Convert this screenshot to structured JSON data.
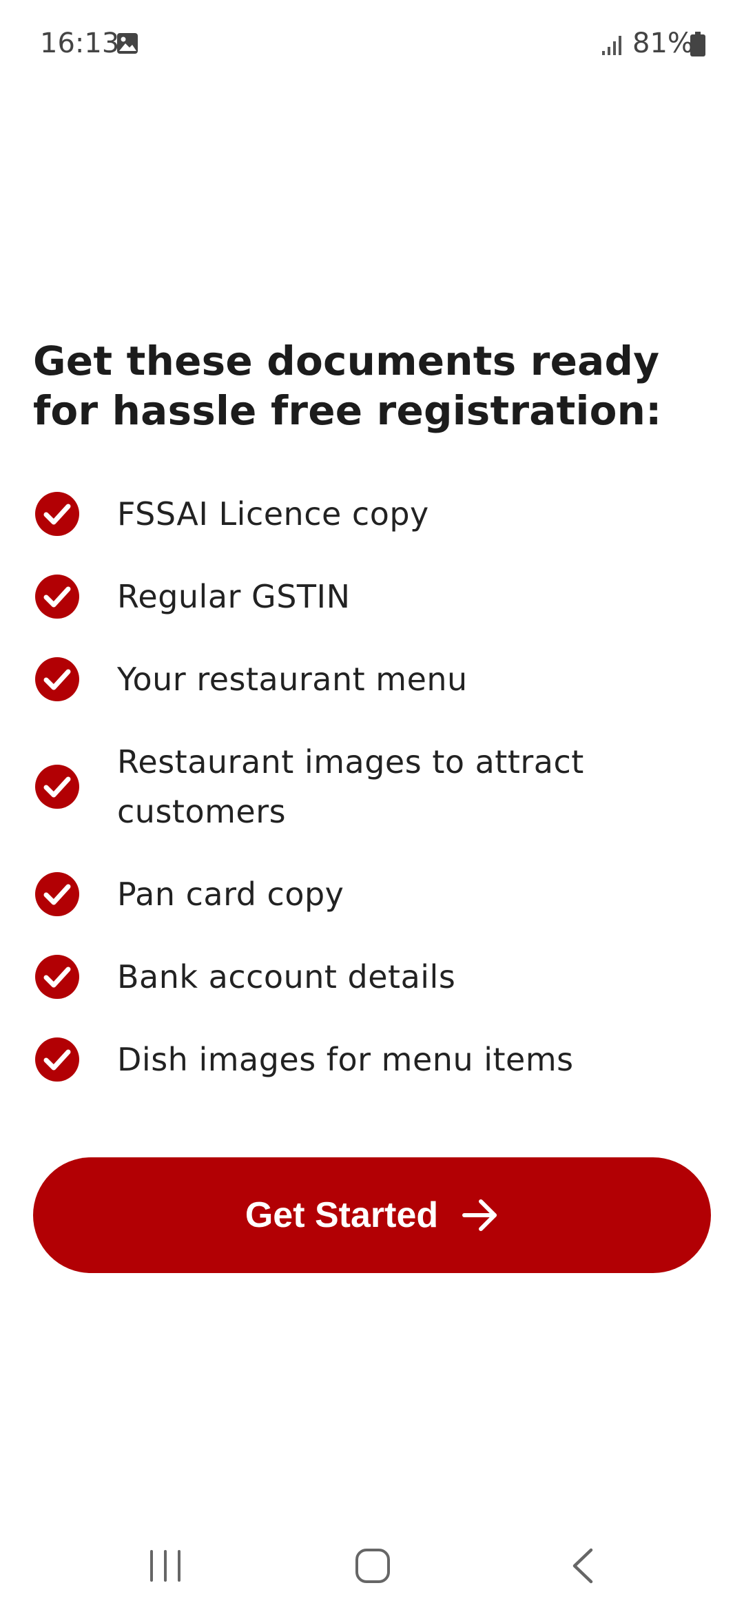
{
  "status_bar": {
    "time": "16:13",
    "battery": "81%",
    "icons": [
      "gallery-icon",
      "signal-icon",
      "battery-icon"
    ]
  },
  "title": "Get these documents ready for hassle free registration:",
  "documents": [
    "FSSAI Licence copy",
    "Regular GSTIN",
    "Your restaurant menu",
    "Restaurant images to attract customers",
    "Pan card copy",
    "Bank account details",
    "Dish images for menu items"
  ],
  "button": {
    "label": "Get Started",
    "icon": "arrow-right-icon"
  },
  "nav_bar": {
    "icons": [
      "recents-icon",
      "home-icon",
      "back-icon"
    ]
  },
  "colors": {
    "accent": "#b20004",
    "text": "#1f1f1f",
    "background": "#ffffff"
  }
}
